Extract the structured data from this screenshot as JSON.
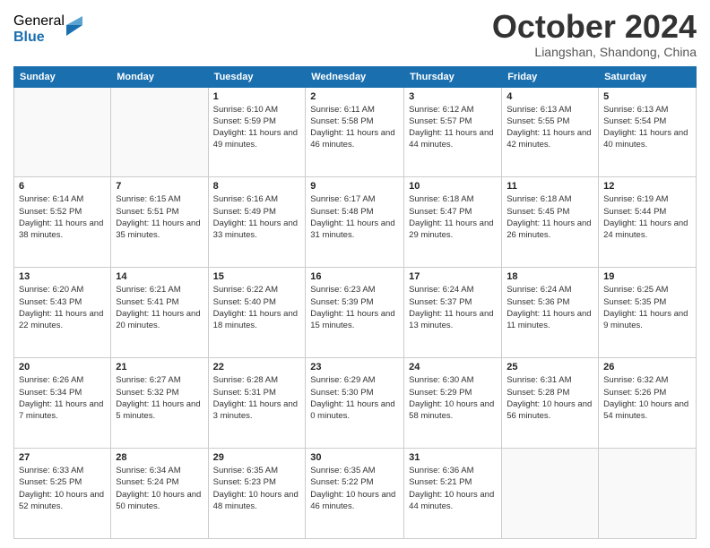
{
  "logo": {
    "general": "General",
    "blue": "Blue"
  },
  "header": {
    "month": "October 2024",
    "location": "Liangshan, Shandong, China"
  },
  "days_of_week": [
    "Sunday",
    "Monday",
    "Tuesday",
    "Wednesday",
    "Thursday",
    "Friday",
    "Saturday"
  ],
  "weeks": [
    [
      {
        "day": "",
        "info": ""
      },
      {
        "day": "",
        "info": ""
      },
      {
        "day": "1",
        "info": "Sunrise: 6:10 AM\nSunset: 5:59 PM\nDaylight: 11 hours and 49 minutes."
      },
      {
        "day": "2",
        "info": "Sunrise: 6:11 AM\nSunset: 5:58 PM\nDaylight: 11 hours and 46 minutes."
      },
      {
        "day": "3",
        "info": "Sunrise: 6:12 AM\nSunset: 5:57 PM\nDaylight: 11 hours and 44 minutes."
      },
      {
        "day": "4",
        "info": "Sunrise: 6:13 AM\nSunset: 5:55 PM\nDaylight: 11 hours and 42 minutes."
      },
      {
        "day": "5",
        "info": "Sunrise: 6:13 AM\nSunset: 5:54 PM\nDaylight: 11 hours and 40 minutes."
      }
    ],
    [
      {
        "day": "6",
        "info": "Sunrise: 6:14 AM\nSunset: 5:52 PM\nDaylight: 11 hours and 38 minutes."
      },
      {
        "day": "7",
        "info": "Sunrise: 6:15 AM\nSunset: 5:51 PM\nDaylight: 11 hours and 35 minutes."
      },
      {
        "day": "8",
        "info": "Sunrise: 6:16 AM\nSunset: 5:49 PM\nDaylight: 11 hours and 33 minutes."
      },
      {
        "day": "9",
        "info": "Sunrise: 6:17 AM\nSunset: 5:48 PM\nDaylight: 11 hours and 31 minutes."
      },
      {
        "day": "10",
        "info": "Sunrise: 6:18 AM\nSunset: 5:47 PM\nDaylight: 11 hours and 29 minutes."
      },
      {
        "day": "11",
        "info": "Sunrise: 6:18 AM\nSunset: 5:45 PM\nDaylight: 11 hours and 26 minutes."
      },
      {
        "day": "12",
        "info": "Sunrise: 6:19 AM\nSunset: 5:44 PM\nDaylight: 11 hours and 24 minutes."
      }
    ],
    [
      {
        "day": "13",
        "info": "Sunrise: 6:20 AM\nSunset: 5:43 PM\nDaylight: 11 hours and 22 minutes."
      },
      {
        "day": "14",
        "info": "Sunrise: 6:21 AM\nSunset: 5:41 PM\nDaylight: 11 hours and 20 minutes."
      },
      {
        "day": "15",
        "info": "Sunrise: 6:22 AM\nSunset: 5:40 PM\nDaylight: 11 hours and 18 minutes."
      },
      {
        "day": "16",
        "info": "Sunrise: 6:23 AM\nSunset: 5:39 PM\nDaylight: 11 hours and 15 minutes."
      },
      {
        "day": "17",
        "info": "Sunrise: 6:24 AM\nSunset: 5:37 PM\nDaylight: 11 hours and 13 minutes."
      },
      {
        "day": "18",
        "info": "Sunrise: 6:24 AM\nSunset: 5:36 PM\nDaylight: 11 hours and 11 minutes."
      },
      {
        "day": "19",
        "info": "Sunrise: 6:25 AM\nSunset: 5:35 PM\nDaylight: 11 hours and 9 minutes."
      }
    ],
    [
      {
        "day": "20",
        "info": "Sunrise: 6:26 AM\nSunset: 5:34 PM\nDaylight: 11 hours and 7 minutes."
      },
      {
        "day": "21",
        "info": "Sunrise: 6:27 AM\nSunset: 5:32 PM\nDaylight: 11 hours and 5 minutes."
      },
      {
        "day": "22",
        "info": "Sunrise: 6:28 AM\nSunset: 5:31 PM\nDaylight: 11 hours and 3 minutes."
      },
      {
        "day": "23",
        "info": "Sunrise: 6:29 AM\nSunset: 5:30 PM\nDaylight: 11 hours and 0 minutes."
      },
      {
        "day": "24",
        "info": "Sunrise: 6:30 AM\nSunset: 5:29 PM\nDaylight: 10 hours and 58 minutes."
      },
      {
        "day": "25",
        "info": "Sunrise: 6:31 AM\nSunset: 5:28 PM\nDaylight: 10 hours and 56 minutes."
      },
      {
        "day": "26",
        "info": "Sunrise: 6:32 AM\nSunset: 5:26 PM\nDaylight: 10 hours and 54 minutes."
      }
    ],
    [
      {
        "day": "27",
        "info": "Sunrise: 6:33 AM\nSunset: 5:25 PM\nDaylight: 10 hours and 52 minutes."
      },
      {
        "day": "28",
        "info": "Sunrise: 6:34 AM\nSunset: 5:24 PM\nDaylight: 10 hours and 50 minutes."
      },
      {
        "day": "29",
        "info": "Sunrise: 6:35 AM\nSunset: 5:23 PM\nDaylight: 10 hours and 48 minutes."
      },
      {
        "day": "30",
        "info": "Sunrise: 6:35 AM\nSunset: 5:22 PM\nDaylight: 10 hours and 46 minutes."
      },
      {
        "day": "31",
        "info": "Sunrise: 6:36 AM\nSunset: 5:21 PM\nDaylight: 10 hours and 44 minutes."
      },
      {
        "day": "",
        "info": ""
      },
      {
        "day": "",
        "info": ""
      }
    ]
  ]
}
